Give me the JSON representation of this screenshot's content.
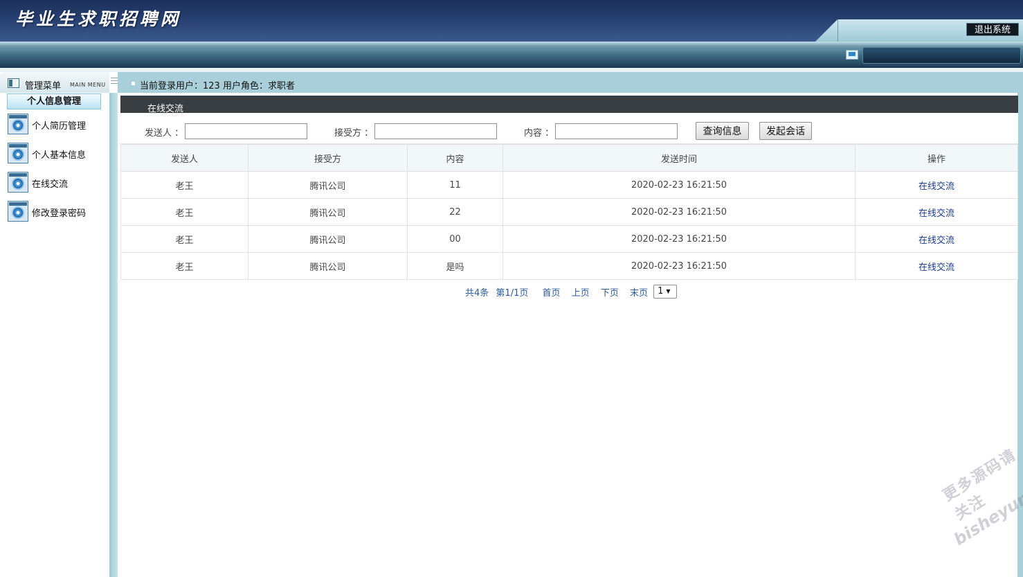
{
  "header": {
    "site_title": "毕业生求职招聘网",
    "logout_label": "退出系统"
  },
  "sidebar": {
    "menu_title": "管理菜单",
    "menu_subtitle": "MAIN MENU",
    "group_title": "个人信息管理",
    "items": [
      {
        "label": "个人简历管理",
        "icon": "gear-icon"
      },
      {
        "label": "个人基本信息",
        "icon": "gear-icon"
      },
      {
        "label": "在线交流",
        "icon": "gear-icon"
      },
      {
        "label": "修改登录密码",
        "icon": "gear-icon"
      }
    ]
  },
  "userbar": {
    "text": "当前登录用户：123  用户角色：求职者"
  },
  "panel": {
    "title": "在线交流"
  },
  "search": {
    "sender_label": "发送人 ：",
    "sender_value": "",
    "receiver_label": "接受方 ：",
    "receiver_value": "",
    "content_label": "内容 ：",
    "content_value": "",
    "query_button": "查询信息",
    "start_button": "发起会话"
  },
  "table": {
    "columns": [
      "发送人",
      "接受方",
      "内容",
      "发送时间",
      "操作"
    ],
    "rows": [
      {
        "sender": "老王",
        "receiver": "腾讯公司",
        "content": "11",
        "time": "2020-02-23 16:21:50",
        "action": "在线交流"
      },
      {
        "sender": "老王",
        "receiver": "腾讯公司",
        "content": "22",
        "time": "2020-02-23 16:21:50",
        "action": "在线交流"
      },
      {
        "sender": "老王",
        "receiver": "腾讯公司",
        "content": "00",
        "time": "2020-02-23 16:21:50",
        "action": "在线交流"
      },
      {
        "sender": "老王",
        "receiver": "腾讯公司",
        "content": "是吗",
        "time": "2020-02-23 16:21:50",
        "action": "在线交流"
      }
    ]
  },
  "pager": {
    "total": "共4条",
    "page_info": "第1/1页",
    "first": "首页",
    "prev": "上页",
    "next": "下页",
    "last": "末页",
    "selected_page": "1"
  },
  "watermark": {
    "line1": "更多源码请关注",
    "line2": "bisheyun.org"
  },
  "colors": {
    "header_dark": "#1c2f5a",
    "panel_title_bg": "#383d42",
    "userbar_bg": "#a9d0da",
    "link": "#1c3c8c"
  }
}
